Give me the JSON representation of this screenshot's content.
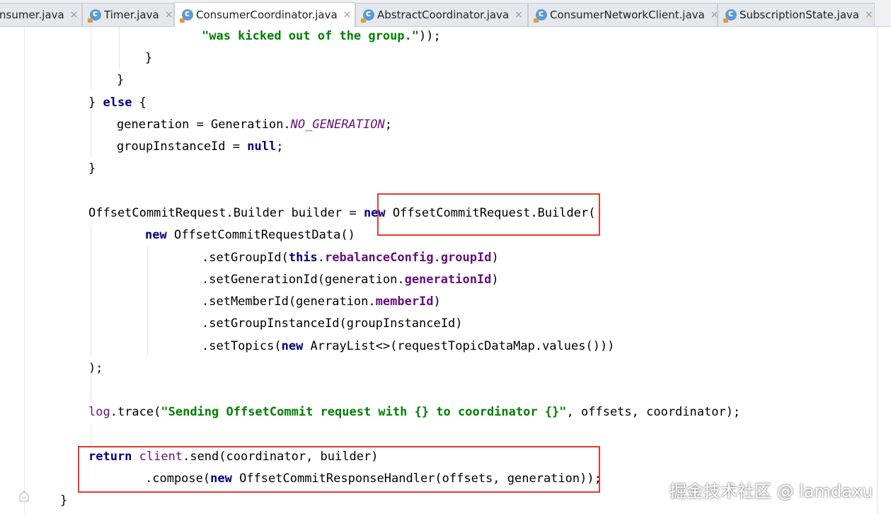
{
  "tabs": [
    {
      "label": "nsumer.java"
    },
    {
      "label": "Timer.java"
    },
    {
      "label": "ConsumerCoordinator.java"
    },
    {
      "label": "AbstractCoordinator.java"
    },
    {
      "label": "ConsumerNetworkClient.java"
    },
    {
      "label": "SubscriptionState.java"
    }
  ],
  "code": {
    "l1_str": "\"was kicked out of the group.\"",
    "l1_end": "));",
    "brace": "}",
    "close_else": "} ",
    "else_kw": "else",
    "else_brace": " {",
    "gen_assign": "generation = Generation.",
    "no_gen": "NO_GENERATION",
    "semi": ";",
    "gi_assign": "groupInstanceId = ",
    "null_kw": "null",
    "builder_decl": "OffsetCommitRequest.Builder builder = ",
    "new_kw": "new",
    "builder_ctor": " OffsetCommitRequest.Builder(",
    "ocrd": " OffsetCommitRequestData()",
    "set_group_pre": ".setGroupId(",
    "this_kw": "this",
    "dot": ".",
    "rebalance_config": "rebalanceConfig",
    "group_id_field": "groupId",
    "close_paren": ")",
    "set_gen_pre": ".setGenerationId(generation.",
    "generation_id_field": "generationId",
    "set_member_pre": ".setMemberId(generation.",
    "member_id_field": "memberId",
    "set_gii": ".setGroupInstanceId(groupInstanceId)",
    "set_topics_pre": ".setTopics(",
    "array_list": " ArrayList<>(requestTopicDataMap.values()))",
    "end_call": ");",
    "log_field": "log",
    "trace_call": ".trace(",
    "trace_str": "\"Sending OffsetCommit request with {} to coordinator {}\"",
    "trace_args": ", offsets, coordinator);",
    "return_kw": "return",
    "client_field": "client",
    "send_call": ".send(coordinator, builder)",
    "compose_pre": ".compose(",
    "handler": " OffsetCommitResponseHandler(offsets, generation));",
    "final_brace": "}"
  },
  "watermark": "掘金技术社区 @ lamdaxu",
  "colors": {
    "keyword": "#000080",
    "string": "#008000",
    "field": "#660e7a",
    "highlight_box": "#e53935"
  }
}
